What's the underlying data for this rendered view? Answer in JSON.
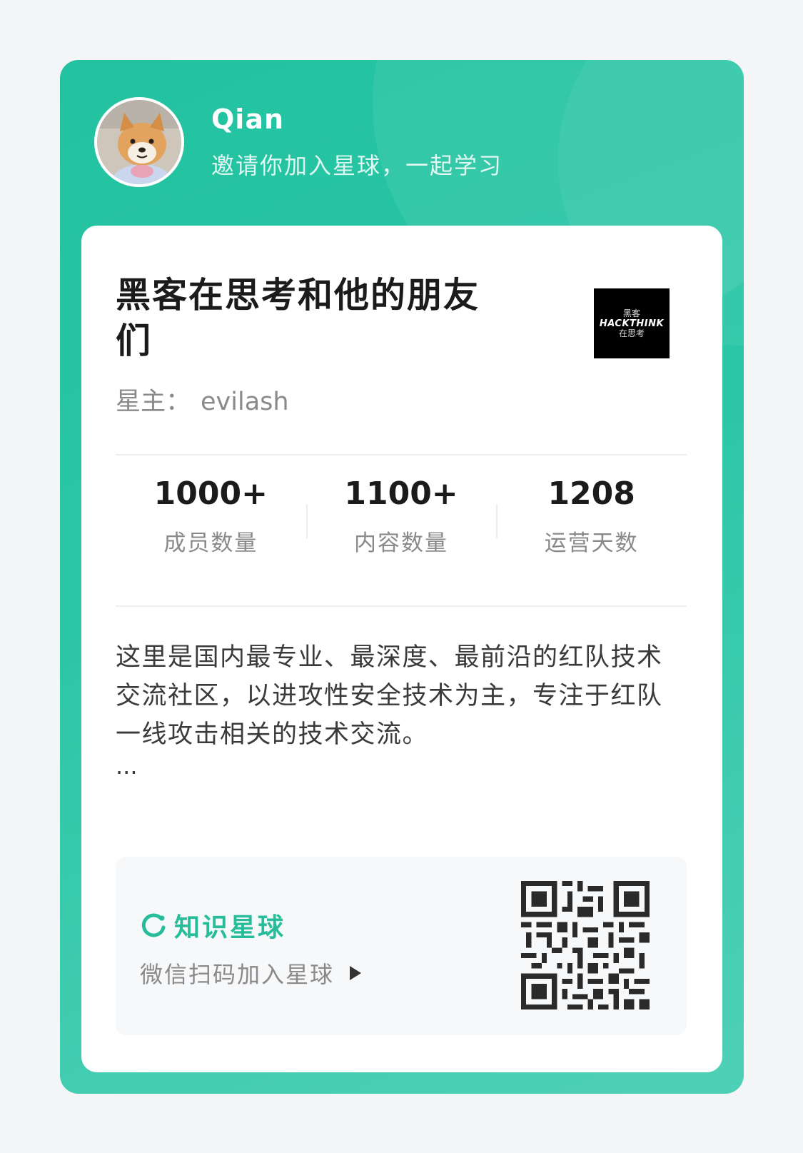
{
  "colors": {
    "accent": "#27bd9a",
    "card_bg": "#2bc6a6",
    "panel_bg": "#ffffff"
  },
  "header": {
    "avatar_icon": "avatar",
    "user_name": "Qian",
    "invite_text": "邀请你加入星球，一起学习"
  },
  "group": {
    "title": "黑客在思考和他的朋友们",
    "owner_label": "星主：",
    "owner_name": "evilash",
    "logo": {
      "top": "黑客",
      "main": "HACKTHINK",
      "bottom": "在思考"
    }
  },
  "stats": [
    {
      "value": "1000+",
      "label": "成员数量"
    },
    {
      "value": "1100+",
      "label": "内容数量"
    },
    {
      "value": "1208",
      "label": "运营天数"
    }
  ],
  "description": "这里是国内最专业、最深度、最前沿的红队技术交流社区，以进攻性安全技术为主，专注于红队一线攻击相关的技术交流。",
  "ellipsis": "...",
  "footer": {
    "brand_icon": "planet-logo-icon",
    "brand_name": "知识星球",
    "scan_text": "微信扫码加入星球",
    "arrow_icon": "play-arrow-icon",
    "qr_icon": "qr-code"
  }
}
